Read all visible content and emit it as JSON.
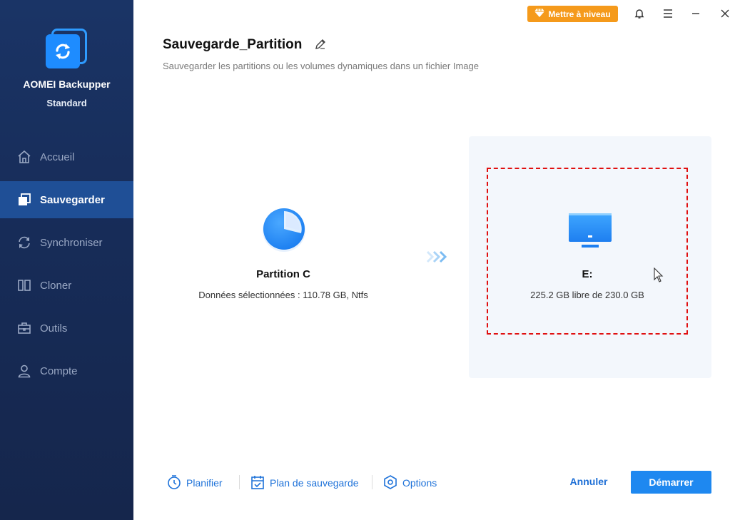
{
  "app": {
    "name": "AOMEI Backupper",
    "edition": "Standard"
  },
  "sidebar": {
    "items": [
      {
        "label": "Accueil",
        "icon": "home-icon",
        "active": false
      },
      {
        "label": "Sauvegarder",
        "icon": "backup-icon",
        "active": true
      },
      {
        "label": "Synchroniser",
        "icon": "sync-icon",
        "active": false
      },
      {
        "label": "Cloner",
        "icon": "clone-icon",
        "active": false
      },
      {
        "label": "Outils",
        "icon": "toolbox-icon",
        "active": false
      },
      {
        "label": "Compte",
        "icon": "user-icon",
        "active": false
      }
    ]
  },
  "titlebar": {
    "upgrade_label": "Mettre à niveau",
    "icons": [
      "diamond-icon",
      "bell-icon",
      "menu-icon",
      "minimize-icon",
      "close-icon"
    ]
  },
  "header": {
    "title": "Sauvegarde_Partition",
    "subtitle": "Sauvegarder les partitions ou les volumes dynamiques dans un fichier Image"
  },
  "source": {
    "name": "Partition C",
    "info": "Données sélectionnées : 110.78 GB, Ntfs",
    "icon": "partition-pie-icon"
  },
  "destination": {
    "name": "E:",
    "info": "225.2 GB libre de 230.0 GB",
    "icon": "monitor-icon"
  },
  "toolbar": {
    "schedule_label": "Planifier",
    "scheme_label": "Plan de sauvegarde",
    "options_label": "Options",
    "cancel_label": "Annuler",
    "start_label": "Démarrer"
  },
  "colors": {
    "sidebar_bg": "#172c58",
    "sidebar_active": "#1f4f96",
    "accent": "#1e88f0",
    "upgrade": "#f59a1b",
    "dest_border": "#e01010"
  }
}
